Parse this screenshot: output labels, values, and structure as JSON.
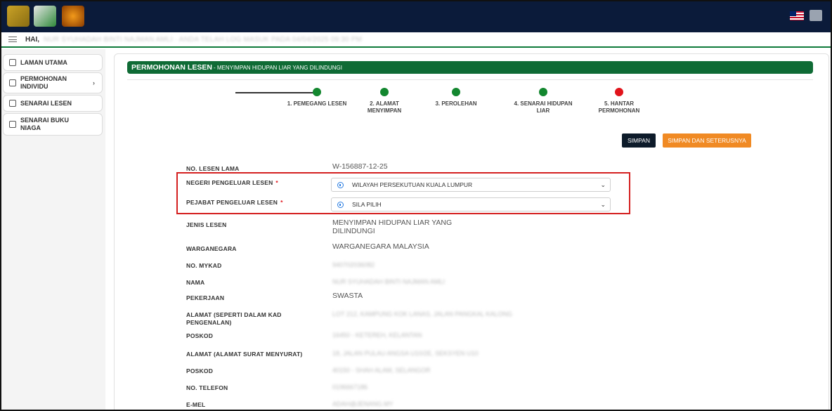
{
  "header": {
    "greeting": "HAI,",
    "greeting_detail": "NUR SYUHADAH BINTI NAJMAN AMLI · ANDA TELAH LOG MASUK PADA 04/04/2025 09:30 PM"
  },
  "sidebar": {
    "items": [
      {
        "label": "LAMAN UTAMA"
      },
      {
        "label": "PERMOHONAN INDIVIDU"
      },
      {
        "label": "SENARAI LESEN"
      },
      {
        "label": "SENARAI BUKU NIAGA"
      }
    ]
  },
  "page": {
    "title": "PERMOHONAN LESEN",
    "subtitle": " - MENYIMPAN HIDUPAN LIAR YANG DILINDUNGI"
  },
  "steps": [
    {
      "label": "1. PEMEGANG LESEN",
      "status": "complete",
      "color": "#13872f"
    },
    {
      "label": "2. ALAMAT MENYIMPAN",
      "status": "complete",
      "color": "#13872f"
    },
    {
      "label": "3. PEROLEHAN",
      "status": "complete",
      "color": "#13872f"
    },
    {
      "label": "4. SENARAI HIDUPAN LIAR",
      "status": "complete",
      "color": "#13872f"
    },
    {
      "label": "5. HANTAR PERMOHONAN",
      "status": "pending",
      "color": "#e1141b"
    }
  ],
  "buttons": {
    "save": "SIMPAN",
    "save_next": "SIMPAN DAN SETERUSNYA"
  },
  "form": {
    "no_lesen_lama": {
      "label": "NO. LESEN LAMA",
      "value": "W-156887-12-25"
    },
    "negeri": {
      "label": "NEGERI PENGELUAR LESEN",
      "required": "*",
      "value": "WILAYAH PERSEKUTUAN KUALA LUMPUR"
    },
    "pejabat": {
      "label": "PEJABAT PENGELUAR LESEN",
      "required": "*",
      "value": "SILA PILIH"
    },
    "jenis": {
      "label": "JENIS LESEN",
      "value": "MENYIMPAN HIDUPAN LIAR YANG DILINDUNGI"
    },
    "warganegara": {
      "label": "WARGANEGARA",
      "value": "WARGANEGARA MALAYSIA"
    },
    "mykad": {
      "label": "NO. MYKAD",
      "value": "940702036082"
    },
    "nama": {
      "label": "NAMA",
      "value": "NUR SYUHADAH BINTI NAJMAN AMLI"
    },
    "pekerjaan": {
      "label": "PEKERJAAN",
      "value": "SWASTA"
    },
    "alamat_kp": {
      "label": "ALAMAT (SEPERTI DALAM KAD PENGENALAN)",
      "value": "LOT 212, KAMPUNG KOK LANAS, JALAN PANGKAL KALONG"
    },
    "poskod1": {
      "label": "POSKOD",
      "value": "16450 - KETEREH, KELANTAN"
    },
    "alamat_surat": {
      "label": "ALAMAT (ALAMAT SURAT MENYURAT)",
      "value": "18, JALAN PULAU ANGSA U10/2E, SEKSYEN U10"
    },
    "poskod2": {
      "label": "POSKOD",
      "value": "40150 - SHAH ALAM, SELANGOR"
    },
    "telefon": {
      "label": "NO. TELEFON",
      "value": "0196667186"
    },
    "emel": {
      "label": "E-MEL",
      "value": "ADAH@JENANG.MY"
    }
  },
  "colors": {
    "header_bg": "#0b1b3a",
    "brand_green": "#0f6b35",
    "step_done": "#13872f",
    "step_pending": "#e1141b",
    "btn_primary": "#0d1b2a",
    "btn_accent": "#f08a24",
    "highlight": "#d42020"
  }
}
